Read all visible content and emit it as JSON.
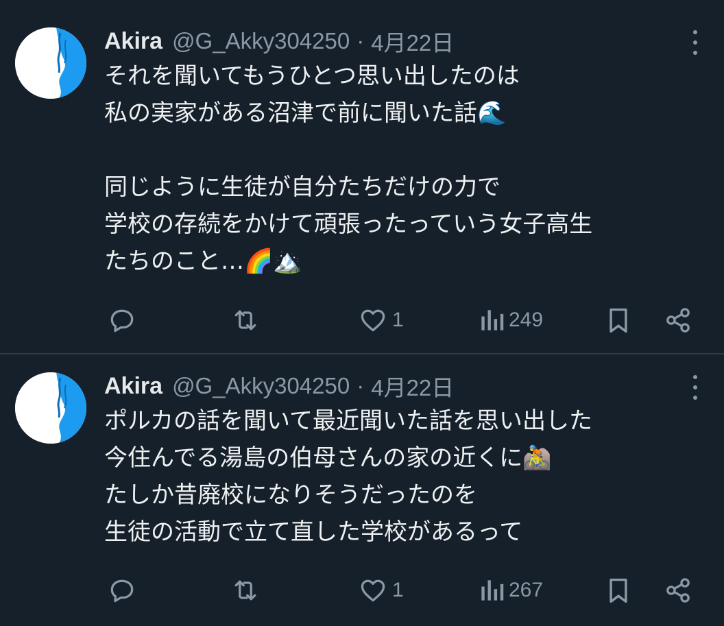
{
  "tweets": [
    {
      "author": "Akira",
      "handle": "@G_Akky304250",
      "separator": "·",
      "date": "4月22日",
      "lines": [
        "それを聞いてもうひとつ思い出したのは",
        "私の実家がある沼津で前に聞いた話🌊",
        "",
        "同じように生徒が自分たちだけの力で",
        "学校の存続をかけて頑張ったっていう女子高生",
        "たちのこと…🌈🏔️"
      ],
      "likes": "1",
      "views": "249"
    },
    {
      "author": "Akira",
      "handle": "@G_Akky304250",
      "separator": "·",
      "date": "4月22日",
      "lines": [
        "ポルカの話を聞いて最近聞いた話を思い出した",
        "今住んでる湯島の伯母さんの家の近くに🚵",
        "たしか昔廃校になりそうだったのを",
        "生徒の活動で立て直した学校があるって"
      ],
      "likes": "1",
      "views": "267"
    }
  ],
  "icons": {
    "reply": "reply-icon",
    "retweet": "retweet-icon",
    "like": "heart-icon",
    "views": "views-chart-icon",
    "bookmark": "bookmark-icon",
    "share": "share-icon",
    "more": "more-vertical-icon"
  },
  "colors": {
    "background": "#15202b",
    "text": "#e7e9ea",
    "secondary": "#8b98a5",
    "divider": "#2f3a44",
    "avatar_accent": "#1d9bf0"
  }
}
